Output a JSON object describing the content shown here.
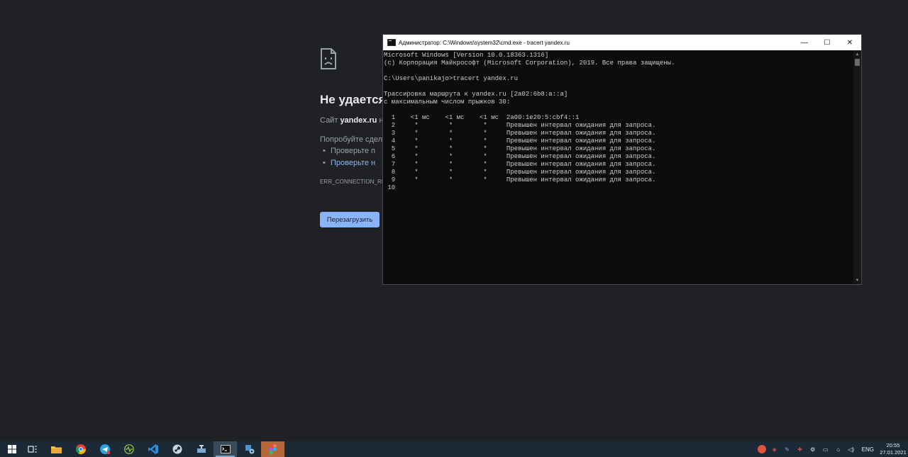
{
  "browser": {
    "error_title": "Не удается",
    "site_prefix": "Сайт ",
    "site_name": "yandex.ru",
    "site_suffix": " не",
    "try_text": "Попробуйте сдела",
    "bullets": [
      "Проверьте п",
      "Проверьте н"
    ],
    "error_code": "ERR_CONNECTION_REFU",
    "reload_label": "Перезагрузить",
    "colors": {
      "background": "#202124",
      "link": "#8ab4f8",
      "button": "#8ab4f8"
    }
  },
  "cmd": {
    "title": "Администратор: C:\\Windows\\system32\\cmd.exe - tracert  yandex.ru",
    "window_buttons": {
      "minimize": "—",
      "maximize": "☐",
      "close": "✕"
    },
    "lines": [
      "Microsoft Windows [Version 10.0.18363.1316]",
      "(c) Корпорация Майкрософт (Microsoft Corporation), 2019. Все права защищены.",
      "",
      "C:\\Users\\panikajo>tracert yandex.ru",
      "",
      "Трассировка маршрута к yandex.ru [2a02:6b8:a::a]",
      "с максимальным числом прыжков 30:",
      "",
      "  1    <1 мс    <1 мс    <1 мс  2a00:1e20:5:cbf4::1",
      "  2     *        *        *     Превышен интервал ожидания для запроса.",
      "  3     *        *        *     Превышен интервал ожидания для запроса.",
      "  4     *        *        *     Превышен интервал ожидания для запроса.",
      "  5     *        *        *     Превышен интервал ожидания для запроса.",
      "  6     *        *        *     Превышен интервал ожидания для запроса.",
      "  7     *        *        *     Превышен интервал ожидания для запроса.",
      "  8     *        *        *     Превышен интервал ожидания для запроса.",
      "  9     *        *        *     Превышен интервал ожидания для запроса.",
      " 10"
    ]
  },
  "taskbar": {
    "apps": [
      {
        "name": "windows-start-icon",
        "color": "#ffffff"
      },
      {
        "name": "task-view-icon",
        "color": "#e6ecf0"
      },
      {
        "name": "file-explorer-icon",
        "color": "#f2c14e"
      },
      {
        "name": "chrome-icon",
        "color": "#db4437"
      },
      {
        "name": "telegram-icon",
        "color": "#2aa3e0"
      },
      {
        "name": "activity-monitor-icon",
        "color": "#9ccc3c"
      },
      {
        "name": "vscode-icon",
        "color": "#2b8cd9"
      },
      {
        "name": "steam-icon",
        "color": "#c7d5e0"
      },
      {
        "name": "network-tool-icon",
        "color": "#7ea9d6"
      },
      {
        "name": "cmd-icon",
        "color": "#111111"
      },
      {
        "name": "app-settings-icon",
        "color": "#4f93c9"
      },
      {
        "name": "figma-icon",
        "color": "#f24e1e"
      }
    ],
    "language": "ENG",
    "time": "20:55",
    "date": "27.01.2021"
  }
}
